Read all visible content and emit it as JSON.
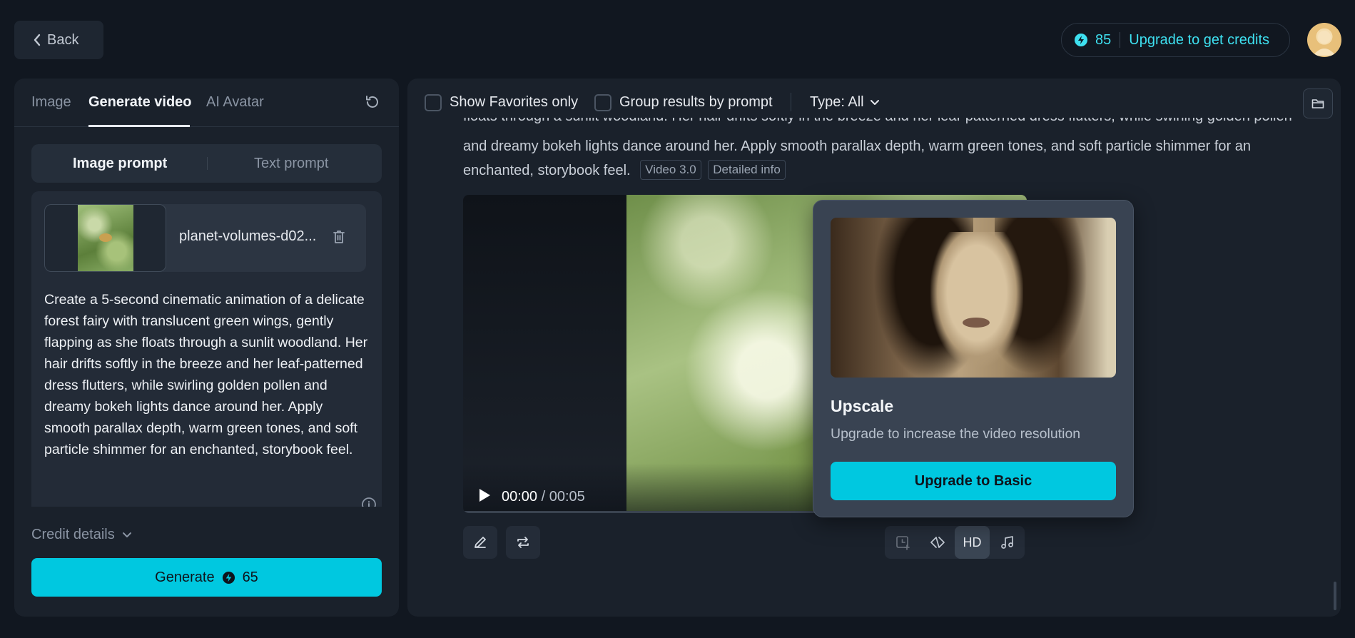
{
  "header": {
    "back_label": "Back",
    "credits_count": "85",
    "upgrade_label": "Upgrade to get credits"
  },
  "left": {
    "tabs": [
      {
        "label": "Image"
      },
      {
        "label": "Generate video"
      },
      {
        "label": "AI Avatar"
      }
    ],
    "segments": {
      "image_prompt": "Image prompt",
      "text_prompt": "Text prompt"
    },
    "file_name": "planet-volumes-d02...",
    "prompt": "Create a 5-second cinematic animation of a delicate forest fairy with translucent green wings, gently flapping as she floats through a sunlit woodland. Her hair drifts softly in the breeze and her leaf-patterned dress flutters, while swirling golden pollen and dreamy bokeh lights dance around her. Apply smooth parallax depth, warm green tones, and soft particle shimmer for an enchanted, storybook feel.",
    "credit_details_label": "Credit details",
    "generate_label": "Generate",
    "generate_cost": "65"
  },
  "results": {
    "filters": {
      "favorites_label": "Show Favorites only",
      "group_label": "Group results by prompt",
      "type_label": "Type: All"
    },
    "prompt_cut_line": "floats through a sunlit woodland. Her hair drifts softly in the breeze and her leaf-patterned dress flutters, while swirling golden pollen",
    "prompt_line_2": "and dreamy bokeh lights dance around her. Apply smooth parallax depth, warm green tones, and soft particle shimmer for an",
    "prompt_line_3": "enchanted, storybook feel.",
    "tags": [
      "Video 3.0",
      "Detailed info"
    ],
    "video": {
      "current_time": "00:00",
      "duration": "/ 00:05"
    },
    "tools": {
      "hd_label": "HD"
    }
  },
  "popover": {
    "title": "Upscale",
    "description": "Upgrade to increase the video resolution",
    "button_label": "Upgrade to Basic"
  },
  "colors": {
    "accent": "#00c8e0",
    "accent_text": "#3ee0f0",
    "background": "#111720",
    "panel": "#1a212b"
  }
}
